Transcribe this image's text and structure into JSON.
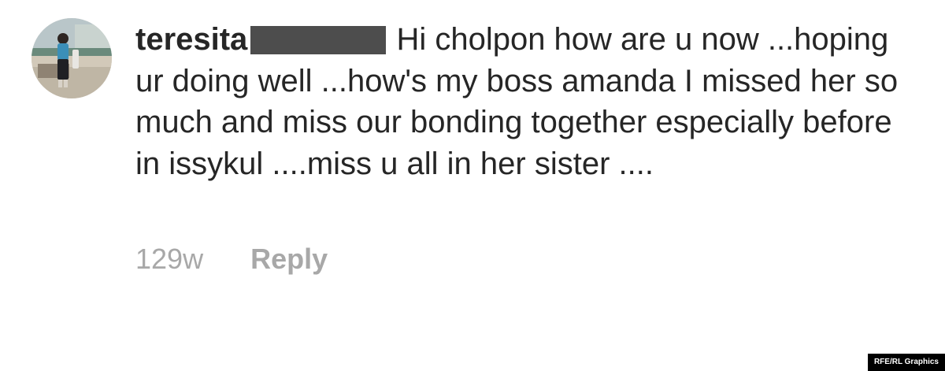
{
  "comment": {
    "username": "teresita",
    "text": "Hi cholpon how are u now ...hoping ur doing well ...how's my boss amanda I missed her so much and miss our bonding together especially before in issykul ....miss u all in her sister ....",
    "timestamp": "129w",
    "reply_label": "Reply"
  },
  "credit": "RFE/RL Graphics",
  "colors": {
    "text": "#262626",
    "muted": "#a8a8a8",
    "redaction": "#4d4d4d"
  }
}
